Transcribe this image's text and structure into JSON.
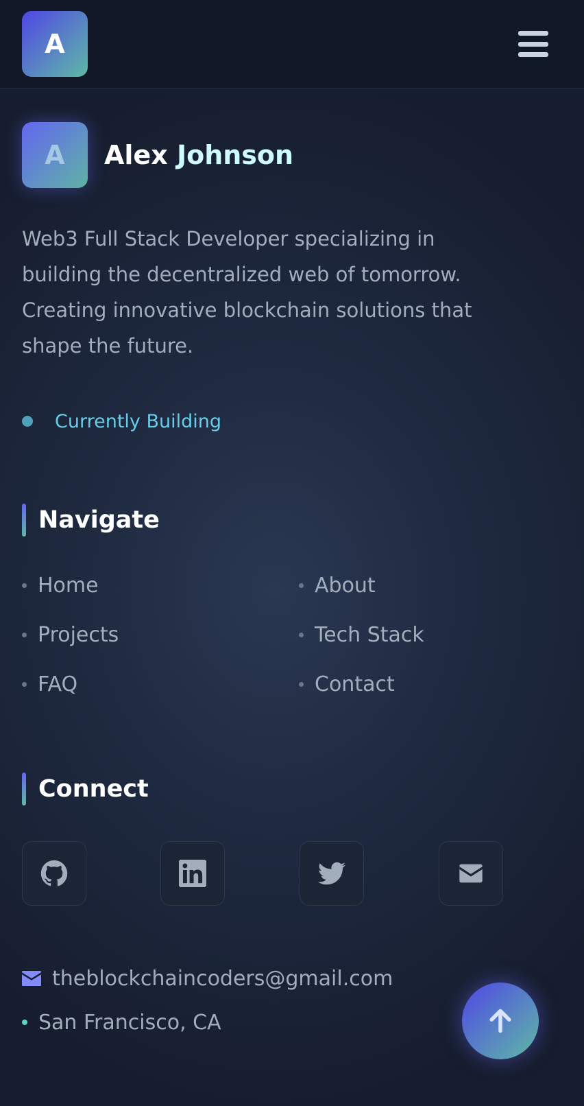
{
  "header": {
    "logo_letter": "A",
    "menu_icon": "hamburger-menu-icon"
  },
  "profile": {
    "avatar_letter": "A",
    "first_name": "Alex",
    "last_name": "Johnson",
    "bio": "Web3 Full Stack Developer specializing in building the decentralized web of tomorrow. Creating innovative blockchain solutions that shape the future.",
    "status": "Currently Building"
  },
  "navigate": {
    "title": "Navigate",
    "items": [
      {
        "label": "Home"
      },
      {
        "label": "About"
      },
      {
        "label": "Projects"
      },
      {
        "label": "Tech Stack"
      },
      {
        "label": "FAQ"
      },
      {
        "label": "Contact"
      }
    ]
  },
  "connect": {
    "title": "Connect",
    "socials": [
      {
        "icon": "github-icon"
      },
      {
        "icon": "linkedin-icon"
      },
      {
        "icon": "twitter-icon"
      },
      {
        "icon": "envelope-icon"
      }
    ],
    "email": "theblockchaincoders@gmail.com",
    "location": "San Francisco, CA"
  },
  "scroll_top_icon": "arrow-up-icon",
  "colors": {
    "accent_start": "#4f46e5",
    "accent_end": "#5fb9a6",
    "status": "#67cde8",
    "background": "#1f2a40"
  }
}
